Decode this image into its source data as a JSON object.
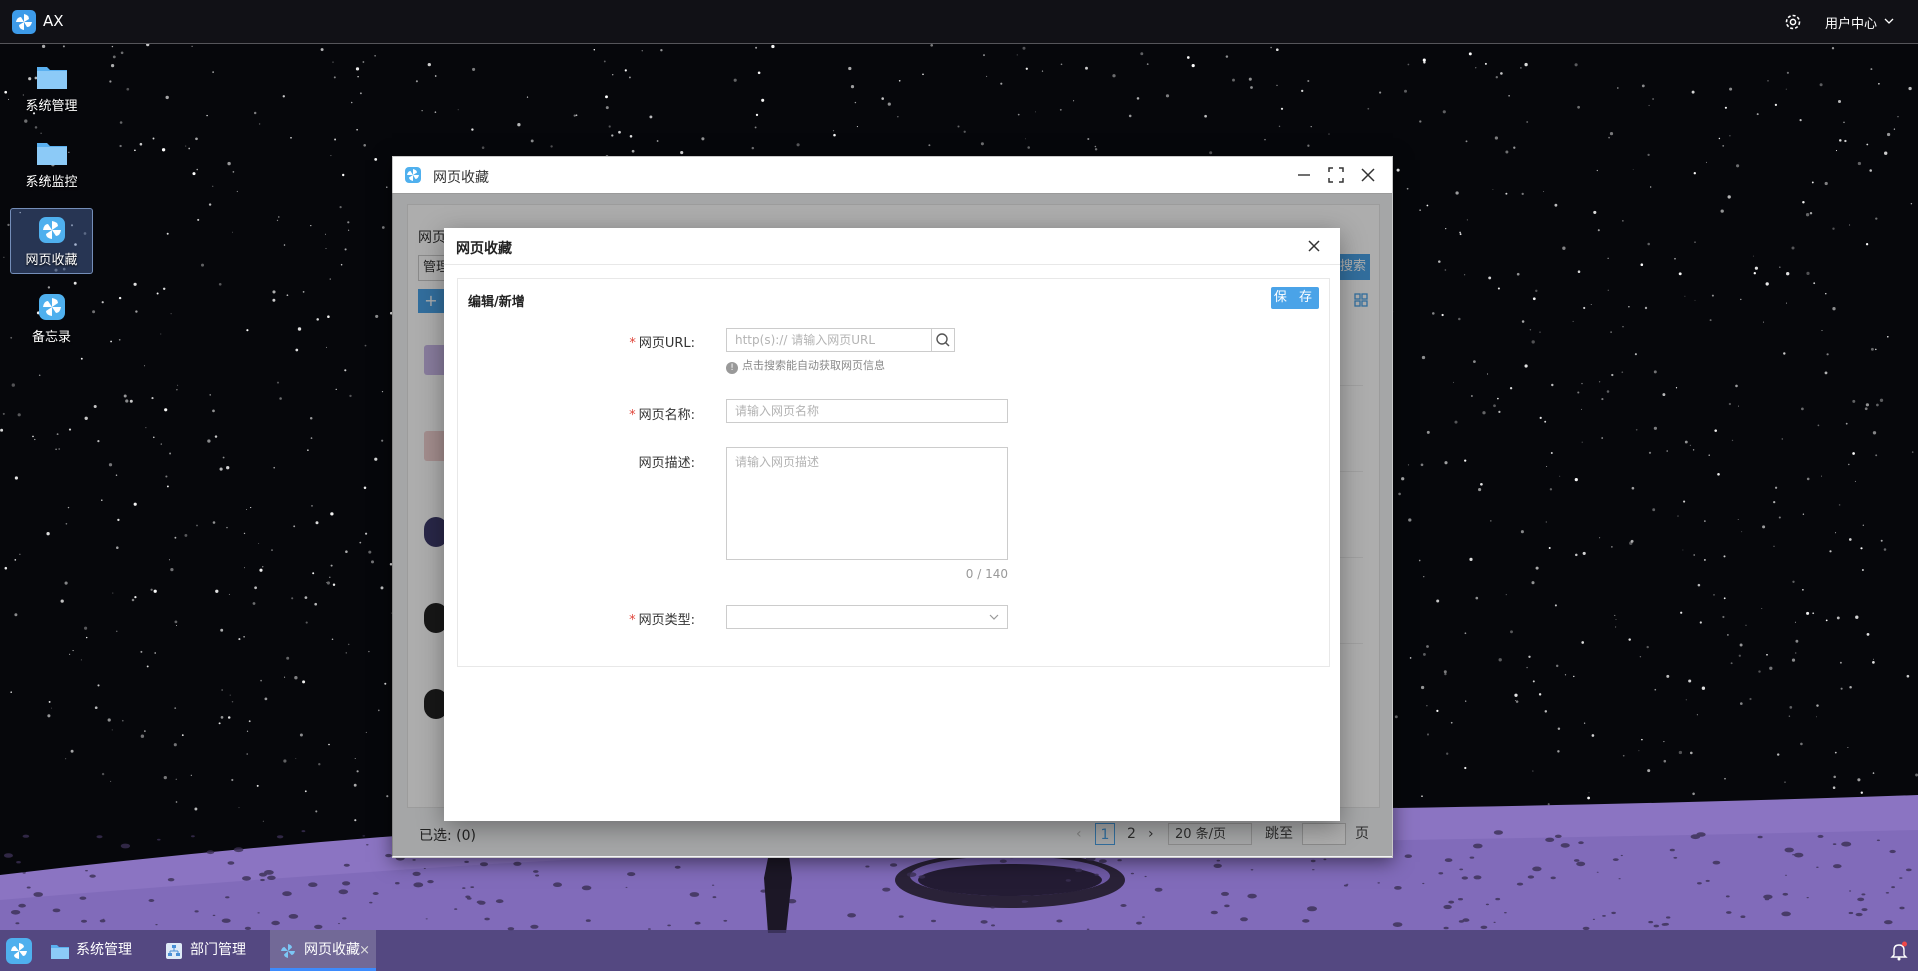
{
  "topbar": {
    "app_name": "AX",
    "user_center": "用户中心",
    "logo_icon": "pinwheel-logo-icon",
    "settings_icon": "gear-icon"
  },
  "desktop": {
    "icons": [
      {
        "label": "系统管理",
        "icon": "folder-icon"
      },
      {
        "label": "系统监控",
        "icon": "folder-icon"
      },
      {
        "label": "网页收藏",
        "icon": "pinwheel-icon",
        "selected": true
      },
      {
        "label": "备忘录",
        "icon": "pinwheel-icon"
      }
    ]
  },
  "window": {
    "title": "网页收藏",
    "panel_title": "网页收藏列表",
    "filter_label": "管理",
    "search_label": "搜索",
    "add_label": "+",
    "status": {
      "selected_label": "已选: (0)",
      "pages": [
        "1",
        "2"
      ],
      "current_page": "1",
      "page_size": "20 条/页",
      "jump_label": "跳至",
      "page_suffix": "页"
    }
  },
  "dialog": {
    "title": "网页收藏",
    "card_title": "编辑/新增",
    "save_label": "保 存",
    "fields": {
      "url": {
        "label": "网页URL:",
        "required": true,
        "prefix": "http(s)://",
        "placeholder": "请输入网页URL",
        "value": "",
        "hint": "点击搜索能自动获取网页信息"
      },
      "name": {
        "label": "网页名称:",
        "required": true,
        "placeholder": "请输入网页名称",
        "value": ""
      },
      "description": {
        "label": "网页描述:",
        "required": false,
        "placeholder": "请输入网页描述",
        "value": "",
        "counter": "0 / 140"
      },
      "type": {
        "label": "网页类型:",
        "required": true,
        "value": ""
      }
    }
  },
  "taskbar": {
    "tasks": [
      {
        "label": "系统管理",
        "icon": "folder-icon",
        "active": false
      },
      {
        "label": "部门管理",
        "icon": "org-chart-icon",
        "active": false
      },
      {
        "label": "网页收藏",
        "icon": "pinwheel-icon",
        "active": true,
        "close": "×"
      }
    ]
  },
  "colors": {
    "accent": "#4aa3e8",
    "required": "#e0453a",
    "taskbar": "#463c6e",
    "moon": "#8b75c0"
  }
}
